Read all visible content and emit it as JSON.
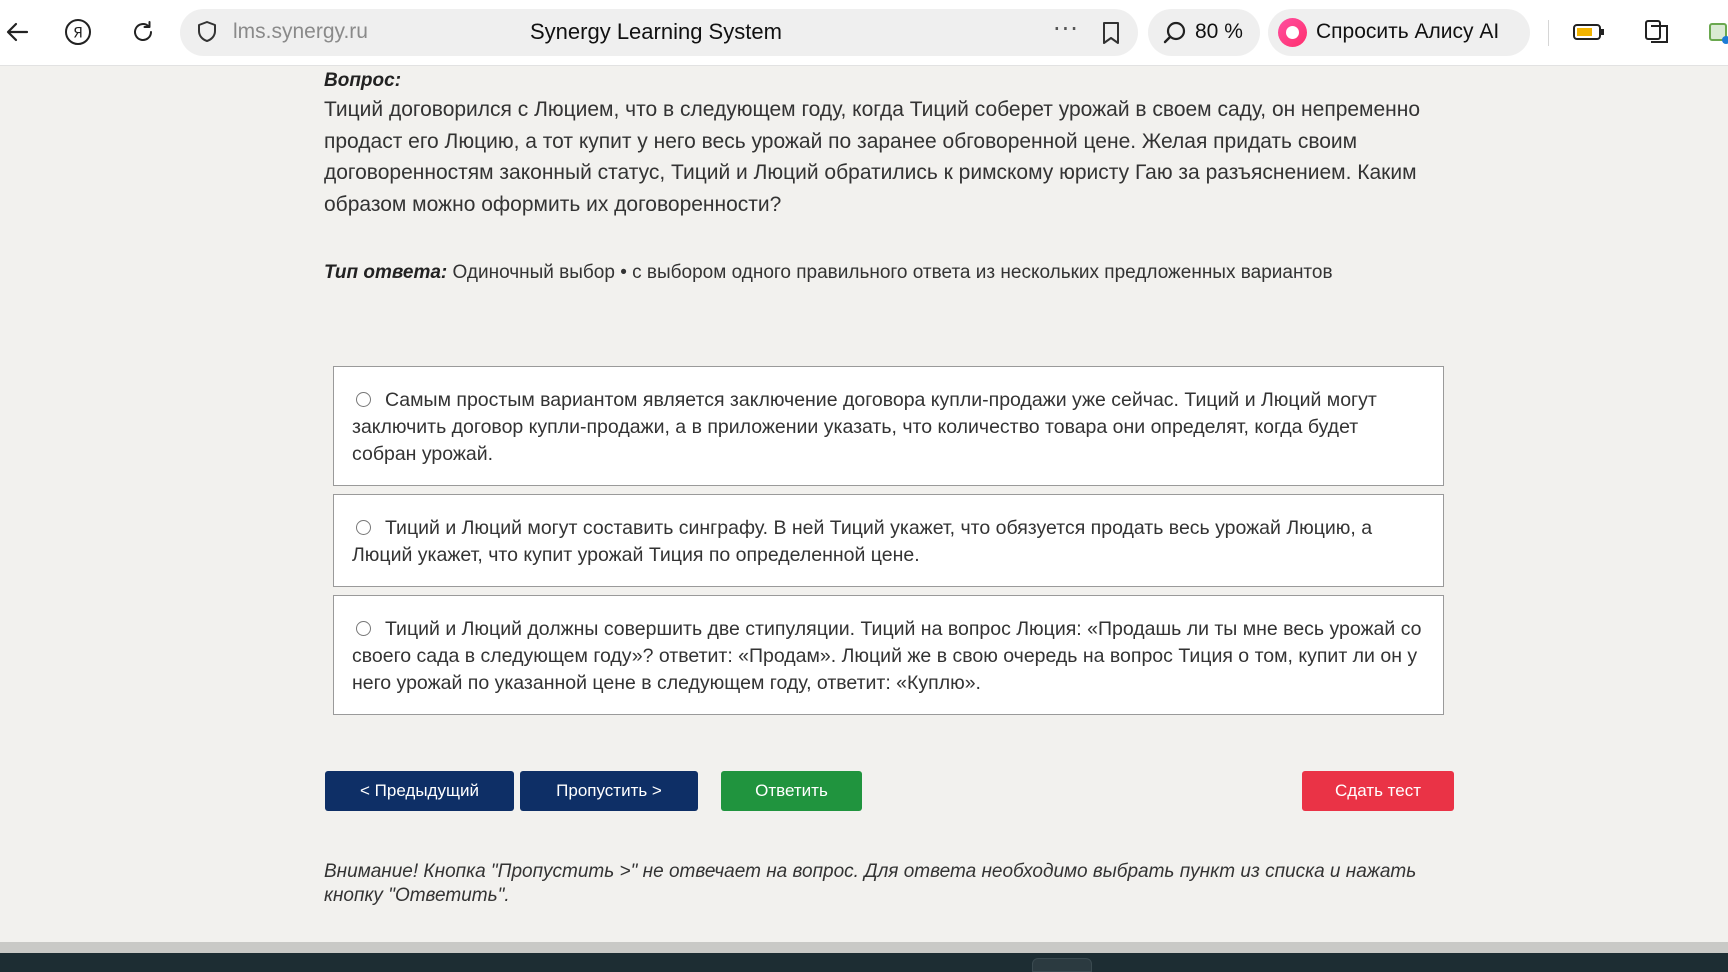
{
  "browser": {
    "url": "lms.synergy.ru",
    "page_title": "Synergy Learning System",
    "zoom": "80 %",
    "alice_label": "Спросить Алису AI",
    "colors": {
      "alice_accent": "#ff2f6d",
      "battery": "#f3b400"
    }
  },
  "question": {
    "label": "Вопрос:",
    "text": "Тиций договорился с Люцием, что в следующем году, когда Тиций соберет урожай в своем саду, он непременно продаст его Люцию, а тот купит у него весь урожай по заранее обговоренной цене. Желая придать своим договоренностям законный статус, Тиций и Люций обратились к римскому юристу Гаю за разъяснением. Каким образом можно оформить их договоренности?"
  },
  "answer_type": {
    "label": "Тип ответа:",
    "value": "Одиночный выбор • с выбором одного правильного ответа из нескольких предложенных вариантов"
  },
  "options": [
    {
      "text": "Самым простым вариантом является заключение договора купли-продажи уже сейчас. Тиций и Люций могут заключить договор купли-продажи, а в приложении указать, что количество товара они определят, когда будет собран урожай.",
      "selected": false
    },
    {
      "text": "Тиций и Люций могут составить синграфу. В ней Тиций укажет, что обязуется продать весь урожай Люцию, а Люций укажет, что купит урожай Тиция по определенной цене.",
      "selected": false
    },
    {
      "text": "Тиций и Люций должны совершить две стипуляции. Тиций на вопрос Люция: «Продашь ли ты мне весь урожай со своего сада в следующем году»? ответит: «Продам». Люций же в свою очередь на вопрос Тиция о том, купит ли он у него урожай по указанной цене в следующем году, ответит: «Куплю».",
      "selected": false
    }
  ],
  "buttons": {
    "prev": "< Предыдущий",
    "skip": "Пропустить >",
    "answer": "Ответить",
    "submit": "Сдать тест"
  },
  "button_colors": {
    "nav": "#0e2f66",
    "answer": "#20943e",
    "submit": "#ea3346"
  },
  "warning": "Внимание! Кнопка \"Пропустить >\" не отвечает на вопрос. Для ответа необходимо выбрать пункт из списка и нажать кнопку \"Ответить\"."
}
